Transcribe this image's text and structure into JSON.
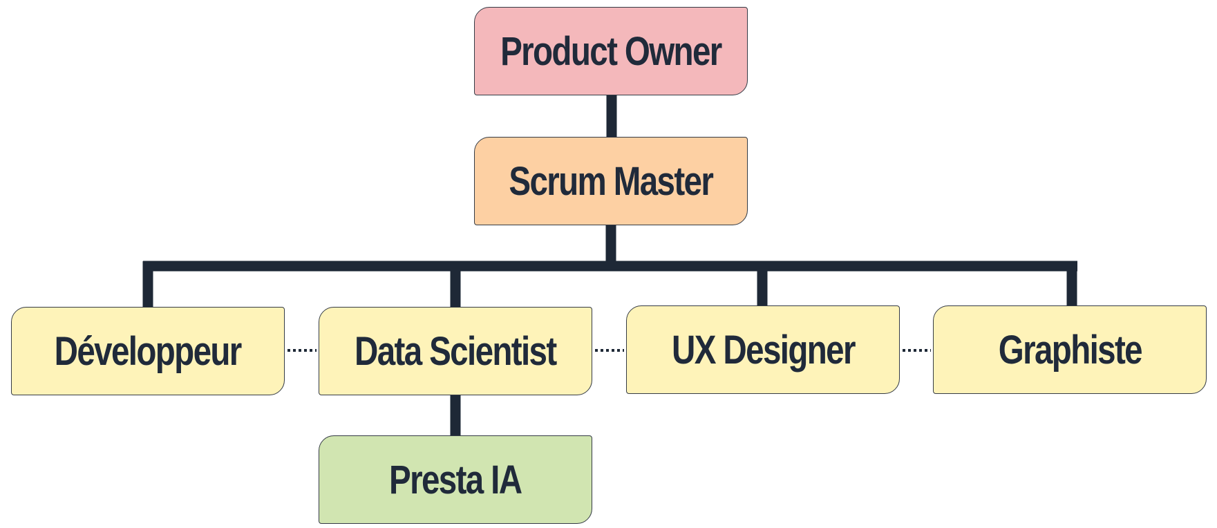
{
  "diagram": {
    "nodes": {
      "product_owner": {
        "label": "Product Owner",
        "color": "#f4b8bb"
      },
      "scrum_master": {
        "label": "Scrum Master",
        "color": "#fdd0a3"
      },
      "developpeur": {
        "label": "Développeur",
        "color": "#fef3b9"
      },
      "data_scientist": {
        "label": "Data Scientist",
        "color": "#fef3b9"
      },
      "ux_designer": {
        "label": "UX Designer",
        "color": "#fef3b9"
      },
      "graphiste": {
        "label": "Graphiste",
        "color": "#fef3b9"
      },
      "presta_ia": {
        "label": "Presta IA",
        "color": "#d1e5b1"
      }
    },
    "line_color": "#1e2836"
  }
}
